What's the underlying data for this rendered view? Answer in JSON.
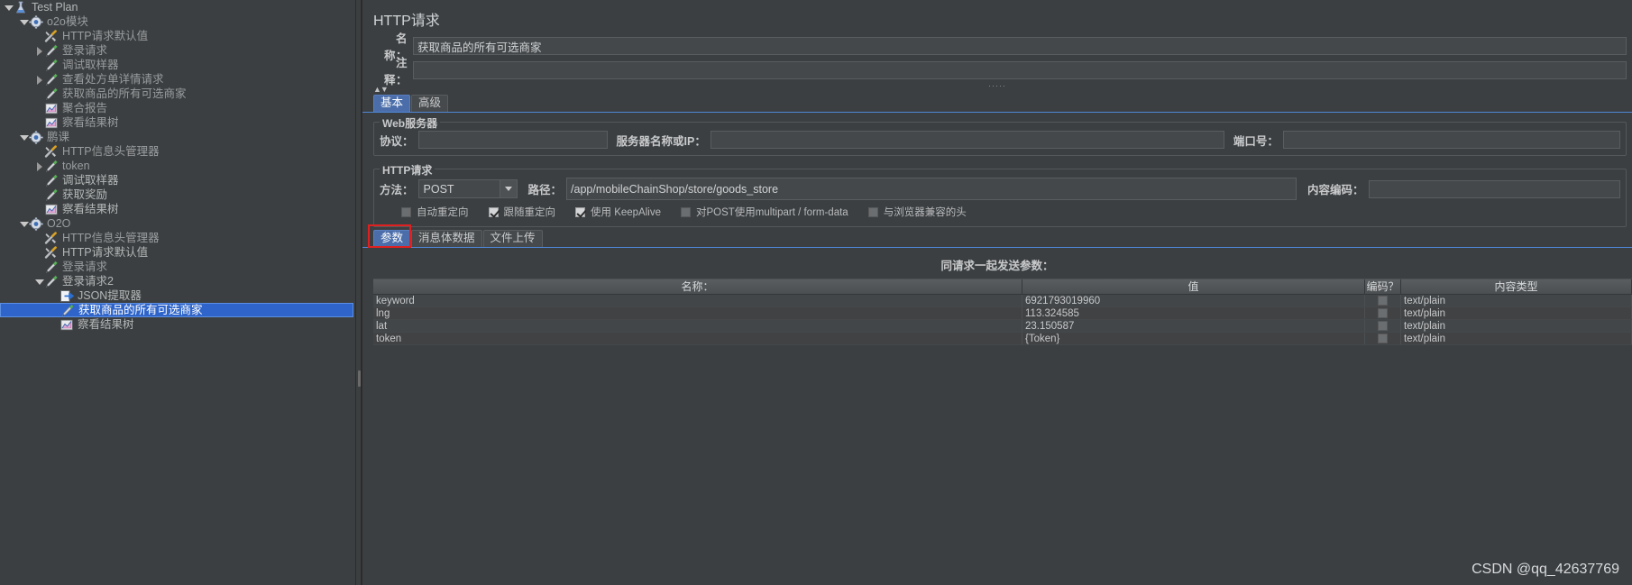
{
  "tree": {
    "nodes": [
      {
        "label": "Test Plan",
        "indent": 0,
        "twisty": "down",
        "icon": "test-plan-icon",
        "dim": false,
        "selected": false
      },
      {
        "label": "o2o模块",
        "indent": 1,
        "twisty": "down",
        "icon": "thread-group-icon",
        "dim": true,
        "selected": false
      },
      {
        "label": "HTTP请求默认值",
        "indent": 2,
        "twisty": "none",
        "icon": "config-icon",
        "dim": true,
        "selected": false
      },
      {
        "label": "登录请求",
        "indent": 2,
        "twisty": "right",
        "icon": "sampler-icon",
        "dim": true,
        "selected": false
      },
      {
        "label": "调试取样器",
        "indent": 2,
        "twisty": "none",
        "icon": "sampler-icon",
        "dim": true,
        "selected": false
      },
      {
        "label": "查看处方单详情请求",
        "indent": 2,
        "twisty": "right",
        "icon": "sampler-icon",
        "dim": true,
        "selected": false
      },
      {
        "label": "获取商品的所有可选商家",
        "indent": 2,
        "twisty": "none",
        "icon": "sampler-icon",
        "dim": true,
        "selected": false
      },
      {
        "label": "聚合报告",
        "indent": 2,
        "twisty": "none",
        "icon": "listener-icon",
        "dim": true,
        "selected": false
      },
      {
        "label": "察看结果树",
        "indent": 2,
        "twisty": "none",
        "icon": "listener-icon",
        "dim": true,
        "selected": false
      },
      {
        "label": "鹏课",
        "indent": 1,
        "twisty": "down",
        "icon": "thread-group-icon",
        "dim": true,
        "selected": false
      },
      {
        "label": "HTTP信息头管理器",
        "indent": 2,
        "twisty": "none",
        "icon": "config-icon",
        "dim": true,
        "selected": false
      },
      {
        "label": "token",
        "indent": 2,
        "twisty": "right",
        "icon": "sampler-icon",
        "dim": true,
        "selected": false
      },
      {
        "label": "调试取样器",
        "indent": 2,
        "twisty": "none",
        "icon": "sampler-icon",
        "dim": false,
        "selected": false
      },
      {
        "label": "获取奖励",
        "indent": 2,
        "twisty": "none",
        "icon": "sampler-icon",
        "dim": false,
        "selected": false
      },
      {
        "label": "察看结果树",
        "indent": 2,
        "twisty": "none",
        "icon": "listener-icon",
        "dim": false,
        "selected": false
      },
      {
        "label": "O2O",
        "indent": 1,
        "twisty": "down",
        "icon": "thread-group-icon",
        "dim": true,
        "selected": false
      },
      {
        "label": "HTTP信息头管理器",
        "indent": 2,
        "twisty": "none",
        "icon": "config-icon",
        "dim": true,
        "selected": false
      },
      {
        "label": "HTTP请求默认值",
        "indent": 2,
        "twisty": "none",
        "icon": "config-icon",
        "dim": false,
        "selected": false
      },
      {
        "label": "登录请求",
        "indent": 2,
        "twisty": "none",
        "icon": "sampler-icon",
        "dim": true,
        "selected": false
      },
      {
        "label": "登录请求2",
        "indent": 2,
        "twisty": "down",
        "icon": "sampler-icon",
        "dim": false,
        "selected": false
      },
      {
        "label": "JSON提取器",
        "indent": 3,
        "twisty": "none",
        "icon": "extractor-icon",
        "dim": false,
        "selected": false
      },
      {
        "label": "获取商品的所有可选商家",
        "indent": 3,
        "twisty": "none",
        "icon": "sampler-icon",
        "dim": false,
        "selected": true
      },
      {
        "label": "察看结果树",
        "indent": 3,
        "twisty": "none",
        "icon": "listener-icon",
        "dim": false,
        "selected": false
      }
    ]
  },
  "panel": {
    "title": "HTTP请求",
    "name_label": "名称：",
    "name_value": "获取商品的所有可选商家",
    "comment_label": "注释：",
    "comment_value": "",
    "tabs": [
      {
        "label": "基本",
        "active": true
      },
      {
        "label": "高级",
        "active": false
      }
    ],
    "web_server": {
      "group_title": "Web服务器",
      "protocol_label": "协议：",
      "protocol_value": "",
      "server_label": "服务器名称或IP：",
      "server_value": "",
      "port_label": "端口号：",
      "port_value": ""
    },
    "http_request": {
      "group_title": "HTTP请求",
      "method_label": "方法：",
      "method_value": "POST",
      "path_label": "路径：",
      "path_value": "/app/mobileChainShop/store/goods_store",
      "encoding_label": "内容编码：",
      "encoding_value": ""
    },
    "options": [
      {
        "label": "自动重定向",
        "checked": false
      },
      {
        "label": "跟随重定向",
        "checked": true
      },
      {
        "label": "使用 KeepAlive",
        "checked": true
      },
      {
        "label": "对POST使用multipart / form-data",
        "checked": false
      },
      {
        "label": "与浏览器兼容的头",
        "checked": false
      }
    ],
    "param_tabs": [
      {
        "label": "参数",
        "active": true
      },
      {
        "label": "消息体数据",
        "active": false
      },
      {
        "label": "文件上传",
        "active": false
      }
    ],
    "send_note": "同请求一起发送参数：",
    "table": {
      "columns": [
        "名称：",
        "值",
        "编码？",
        "内容类型"
      ],
      "rows": [
        {
          "name": "keyword",
          "value": "6921793019960",
          "encode": false,
          "type": "text/plain"
        },
        {
          "name": "lng",
          "value": "113.324585",
          "encode": false,
          "type": "text/plain"
        },
        {
          "name": "lat",
          "value": "23.150587",
          "encode": false,
          "type": "text/plain"
        },
        {
          "name": "token",
          "value": "{Token}",
          "encode": false,
          "type": "text/plain"
        }
      ]
    }
  },
  "watermark": "CSDN @qq_42637769"
}
